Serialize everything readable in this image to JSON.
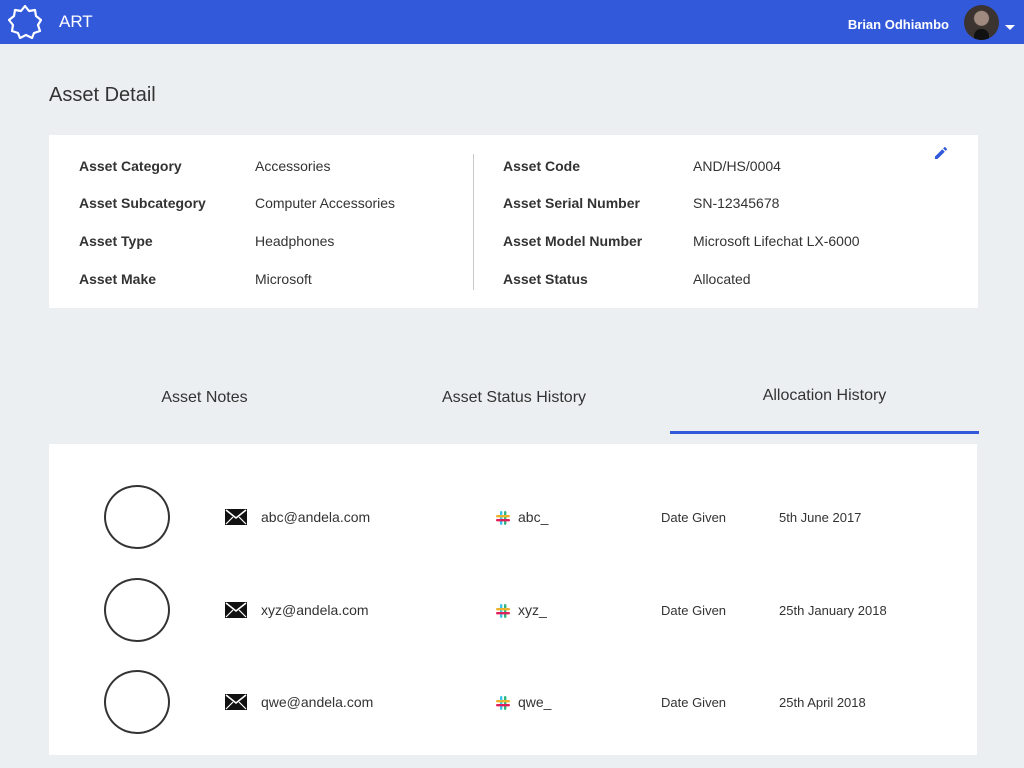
{
  "topbar": {
    "app_title": "ART",
    "user_name": "Brian Odhiambo",
    "brand_color": "#3359db"
  },
  "page": {
    "title": "Asset Detail"
  },
  "asset_detail": {
    "left": [
      {
        "label": "Asset Category",
        "value": "Accessories"
      },
      {
        "label": "Asset Subcategory",
        "value": "Computer Accessories"
      },
      {
        "label": "Asset Type",
        "value": "Headphones"
      },
      {
        "label": "Asset Make",
        "value": "Microsoft"
      }
    ],
    "right": [
      {
        "label": "Asset Code",
        "value": "AND/HS/0004"
      },
      {
        "label": "Asset Serial Number",
        "value": "SN-12345678"
      },
      {
        "label": "Asset Model Number",
        "value": "Microsoft Lifechat LX-6000"
      },
      {
        "label": "Asset Status",
        "value": "Allocated"
      }
    ],
    "edit_icon": "pencil-icon"
  },
  "tabs": [
    {
      "label": "Asset Notes",
      "active": false
    },
    {
      "label": "Asset Status History",
      "active": false
    },
    {
      "label": "Allocation History",
      "active": true
    }
  ],
  "allocation_history": [
    {
      "email": "abc@andela.com",
      "slack": "abc_",
      "date_label": "Date Given",
      "date": "5th June 2017"
    },
    {
      "email": "xyz@andela.com",
      "slack": "xyz_",
      "date_label": "Date Given",
      "date": "25th January 2018"
    },
    {
      "email": "qwe@andela.com",
      "slack": "qwe_",
      "date_label": "Date Given",
      "date": "25th April 2018"
    }
  ]
}
